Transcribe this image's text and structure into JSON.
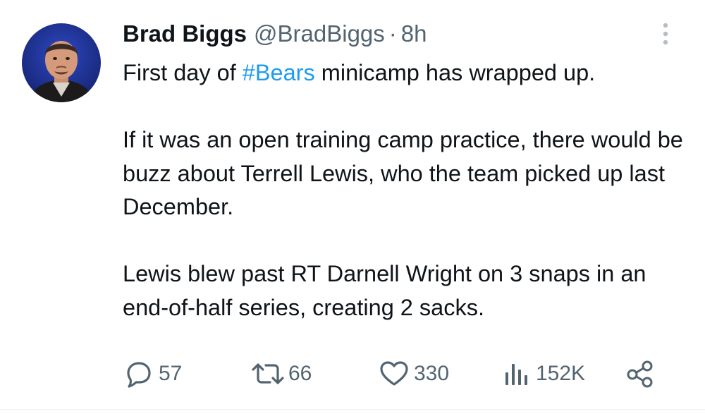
{
  "author": {
    "display_name": "Brad Biggs",
    "handle": "@BradBiggs",
    "separator": "·",
    "time": "8h",
    "avatar_icon": "profile-photo"
  },
  "tweet": {
    "line1_before": "First day of ",
    "hashtag": "#Bears",
    "line1_after": " minicamp has wrapped up.",
    "paragraph2": "If it was an open training camp practice, there would be buzz about Terrell Lewis, who the team picked up last December.",
    "paragraph3": "Lewis blew past RT Darnell Wright on 3 snaps in an end-of-half series, creating 2 sacks."
  },
  "actions": {
    "reply_count": "57",
    "retweet_count": "66",
    "like_count": "330",
    "views_count": "152K",
    "reply_icon": "reply-icon",
    "retweet_icon": "retweet-icon",
    "like_icon": "heart-icon",
    "views_icon": "views-icon",
    "share_icon": "share-icon"
  },
  "colors": {
    "text": "#0f1419",
    "secondary": "#536471",
    "accent": "#1d9bf0",
    "avatar_bg": "#1d2f8a"
  }
}
